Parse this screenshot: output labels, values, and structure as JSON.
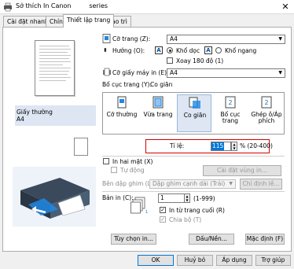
{
  "window": {
    "title": "Sở thích In Canon",
    "title_suffix": "series"
  },
  "tabs": [
    {
      "label": "Cài đặt nhanh"
    },
    {
      "label": "Chính"
    },
    {
      "label": "Thiết lập trang"
    },
    {
      "label": "Bảo trì"
    }
  ],
  "left": {
    "paper_type": "Giấy thường",
    "paper_size": "A4"
  },
  "page_size": {
    "label": "Cỡ trang",
    "hotkey": "(Z):",
    "value": "A4"
  },
  "orientation": {
    "label": "Hướng",
    "hotkey": "(O):",
    "portrait": "Khổ dọc",
    "landscape": "Khổ ngang",
    "rotate180": "Xoay 180 độ (1)",
    "portrait_selected": true
  },
  "printer_paper_size": {
    "label": "Cỡ giấy máy in",
    "hotkey": "(E):",
    "value": "A4"
  },
  "layout": {
    "label": "Bố cục trang (Y):",
    "current": "Co giãn",
    "items": [
      {
        "label": "Cỡ thường"
      },
      {
        "label": "Vừa trang"
      },
      {
        "label": "Co giãn"
      },
      {
        "label": "Bố cục trang"
      },
      {
        "label": "Ghép ô/Áp phích"
      }
    ]
  },
  "scaling": {
    "label": "Tỉ lệ:",
    "value": "115",
    "range": "% (20-400)"
  },
  "duplex": {
    "label": "In hai mặt (X)",
    "auto": "Tự động",
    "area_button": "Cài đặt vùng in..."
  },
  "stapling": {
    "label": "Bên dập ghim (L):",
    "value": "Dập ghim cạnh dài (Trái)",
    "margin_button": "Chỉ định lề..."
  },
  "copies": {
    "label": "Bản in (C):",
    "value": "1",
    "range": "(1-999)",
    "reverse": "In từ trang cuối (R)",
    "collate": "Chia bộ (T)",
    "reverse_checked": true,
    "collate_checked": true
  },
  "bottom_buttons": {
    "options": "Tùy chọn in...",
    "stamp": "Dấu/Nền...",
    "defaults": "Mặc định (F)"
  },
  "dialog_buttons": {
    "ok": "OK",
    "cancel": "Huỷ bỏ",
    "apply": "Áp dụng",
    "help": "Trợ giúp"
  },
  "colors": {
    "accent": "#0078d7",
    "highlight": "#d40000",
    "selected_bg": "#dde6f2"
  },
  "icons": [
    "printer-icon",
    "close-icon",
    "page-size-icon",
    "paper-size-icon",
    "copies-icon"
  ]
}
